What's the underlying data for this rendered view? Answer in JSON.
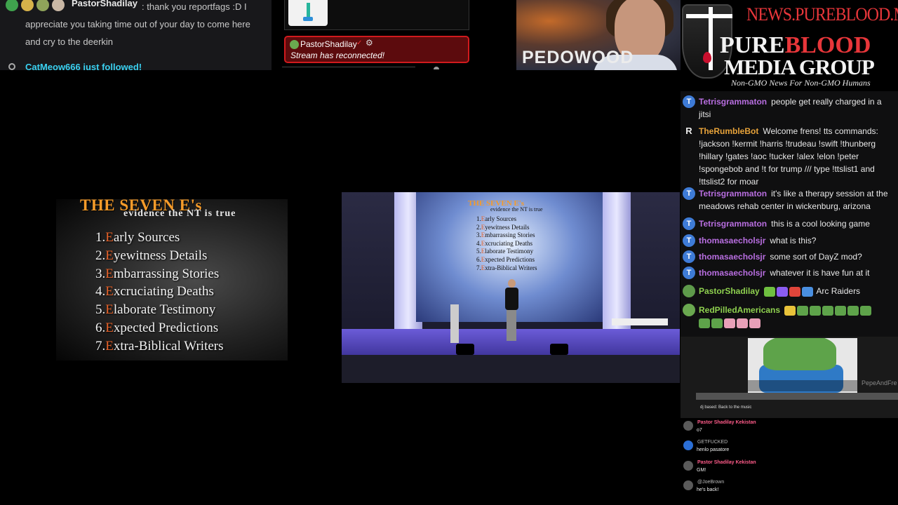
{
  "top_chat": {
    "username": "PastorShadilay",
    "message": ": thank you reportfags :D I appreciate you taking time out of your day to come here and cry to the deerkin",
    "follow_text": "CatMeow666 just followed!"
  },
  "reconnect": {
    "username": "PastorShadilay",
    "message": "Stream has reconnected!"
  },
  "video_overlay_text": "PEDOWOOD",
  "logo": {
    "url": "NEWS.PUREBLOOD.MEDIA",
    "line1_initial": "P",
    "line1_rest": "URE",
    "line1_red": "BLOOD",
    "line2": "MEDIA GROUP",
    "tagline": "Non-GMO News For Non-GMO Humans"
  },
  "right_chat": [
    {
      "avatar": "T",
      "avatar_color": "#3e7bd6",
      "user": "Tetrisgrammaton",
      "user_color": "#b86ee0",
      "text": "people get really charged in a jitsi"
    },
    {
      "avatar": "R",
      "avatar_color": "#0f0f10",
      "user": "TheRumbleBot",
      "user_color": "#e8a33a",
      "text": "Welcome frens! tts commands: !jackson !kermit !harris !trudeau !swift !thunberg !hillary !gates !aoc !tucker !alex !elon !peter !spongebob and !t for trump /// type !ttslist1 and !ttslist2 for moar"
    },
    {
      "avatar": "T",
      "avatar_color": "#3e7bd6",
      "user": "Tetrisgrammaton",
      "user_color": "#b86ee0",
      "text": "it's like a therapy session at the meadows rehab center in wickenburg, arizona"
    },
    {
      "avatar": "T",
      "avatar_color": "#3e7bd6",
      "user": "Tetrisgrammaton",
      "user_color": "#b86ee0",
      "text": "this is a cool looking game"
    },
    {
      "avatar": "T",
      "avatar_color": "#3e7bd6",
      "user": "thomasaecholsjr",
      "user_color": "#b86ee0",
      "text": "what is this?"
    },
    {
      "avatar": "T",
      "avatar_color": "#3e7bd6",
      "user": "thomasaecholsjr",
      "user_color": "#b86ee0",
      "text": "some sort of DayZ mod?"
    },
    {
      "avatar": "T",
      "avatar_color": "#3e7bd6",
      "user": "thomasaecholsjr",
      "user_color": "#b86ee0",
      "text": "whatever it is have fun at it"
    },
    {
      "avatar": "",
      "avatar_color": "#5e9a4a",
      "user": "PastorShadilay",
      "user_color": "#8fd14f",
      "text": "Arc Raiders"
    },
    {
      "avatar": "",
      "avatar_color": "#6aa84f",
      "user": "RedPilledAmericans",
      "user_color": "#8fd14f",
      "text": ""
    }
  ],
  "embed": {
    "caption": "PepeAndFre",
    "seek_caption": "dj based: Back to the music"
  },
  "bottom_chat": [
    {
      "name": "Pastor Shadilay Kekistan",
      "pink": true,
      "text": "o7"
    },
    {
      "name": "GETFUCKED",
      "pink": false,
      "text": "henlo pasatore"
    },
    {
      "name": "Pastor Shadilay Kekistan",
      "pink": true,
      "text": "GM!"
    },
    {
      "name": "@JoeBrown",
      "pink": false,
      "text": "he's back!"
    }
  ],
  "slide": {
    "title": "THE SEVEN E's",
    "subtitle": "evidence the NT is true",
    "items": [
      {
        "num": "1.",
        "first": "E",
        "rest": "arly Sources"
      },
      {
        "num": "2.",
        "first": "E",
        "rest": "yewitness Details"
      },
      {
        "num": "3.",
        "first": "E",
        "rest": "mbarrassing Stories"
      },
      {
        "num": "4.",
        "first": "E",
        "rest": "xcruciating Deaths"
      },
      {
        "num": "5.",
        "first": "E",
        "rest": "laborate Testimony"
      },
      {
        "num": "6.",
        "first": "E",
        "rest": "xpected Predictions"
      },
      {
        "num": "7.",
        "first": "E",
        "rest": "xtra-Biblical Writers"
      }
    ]
  }
}
